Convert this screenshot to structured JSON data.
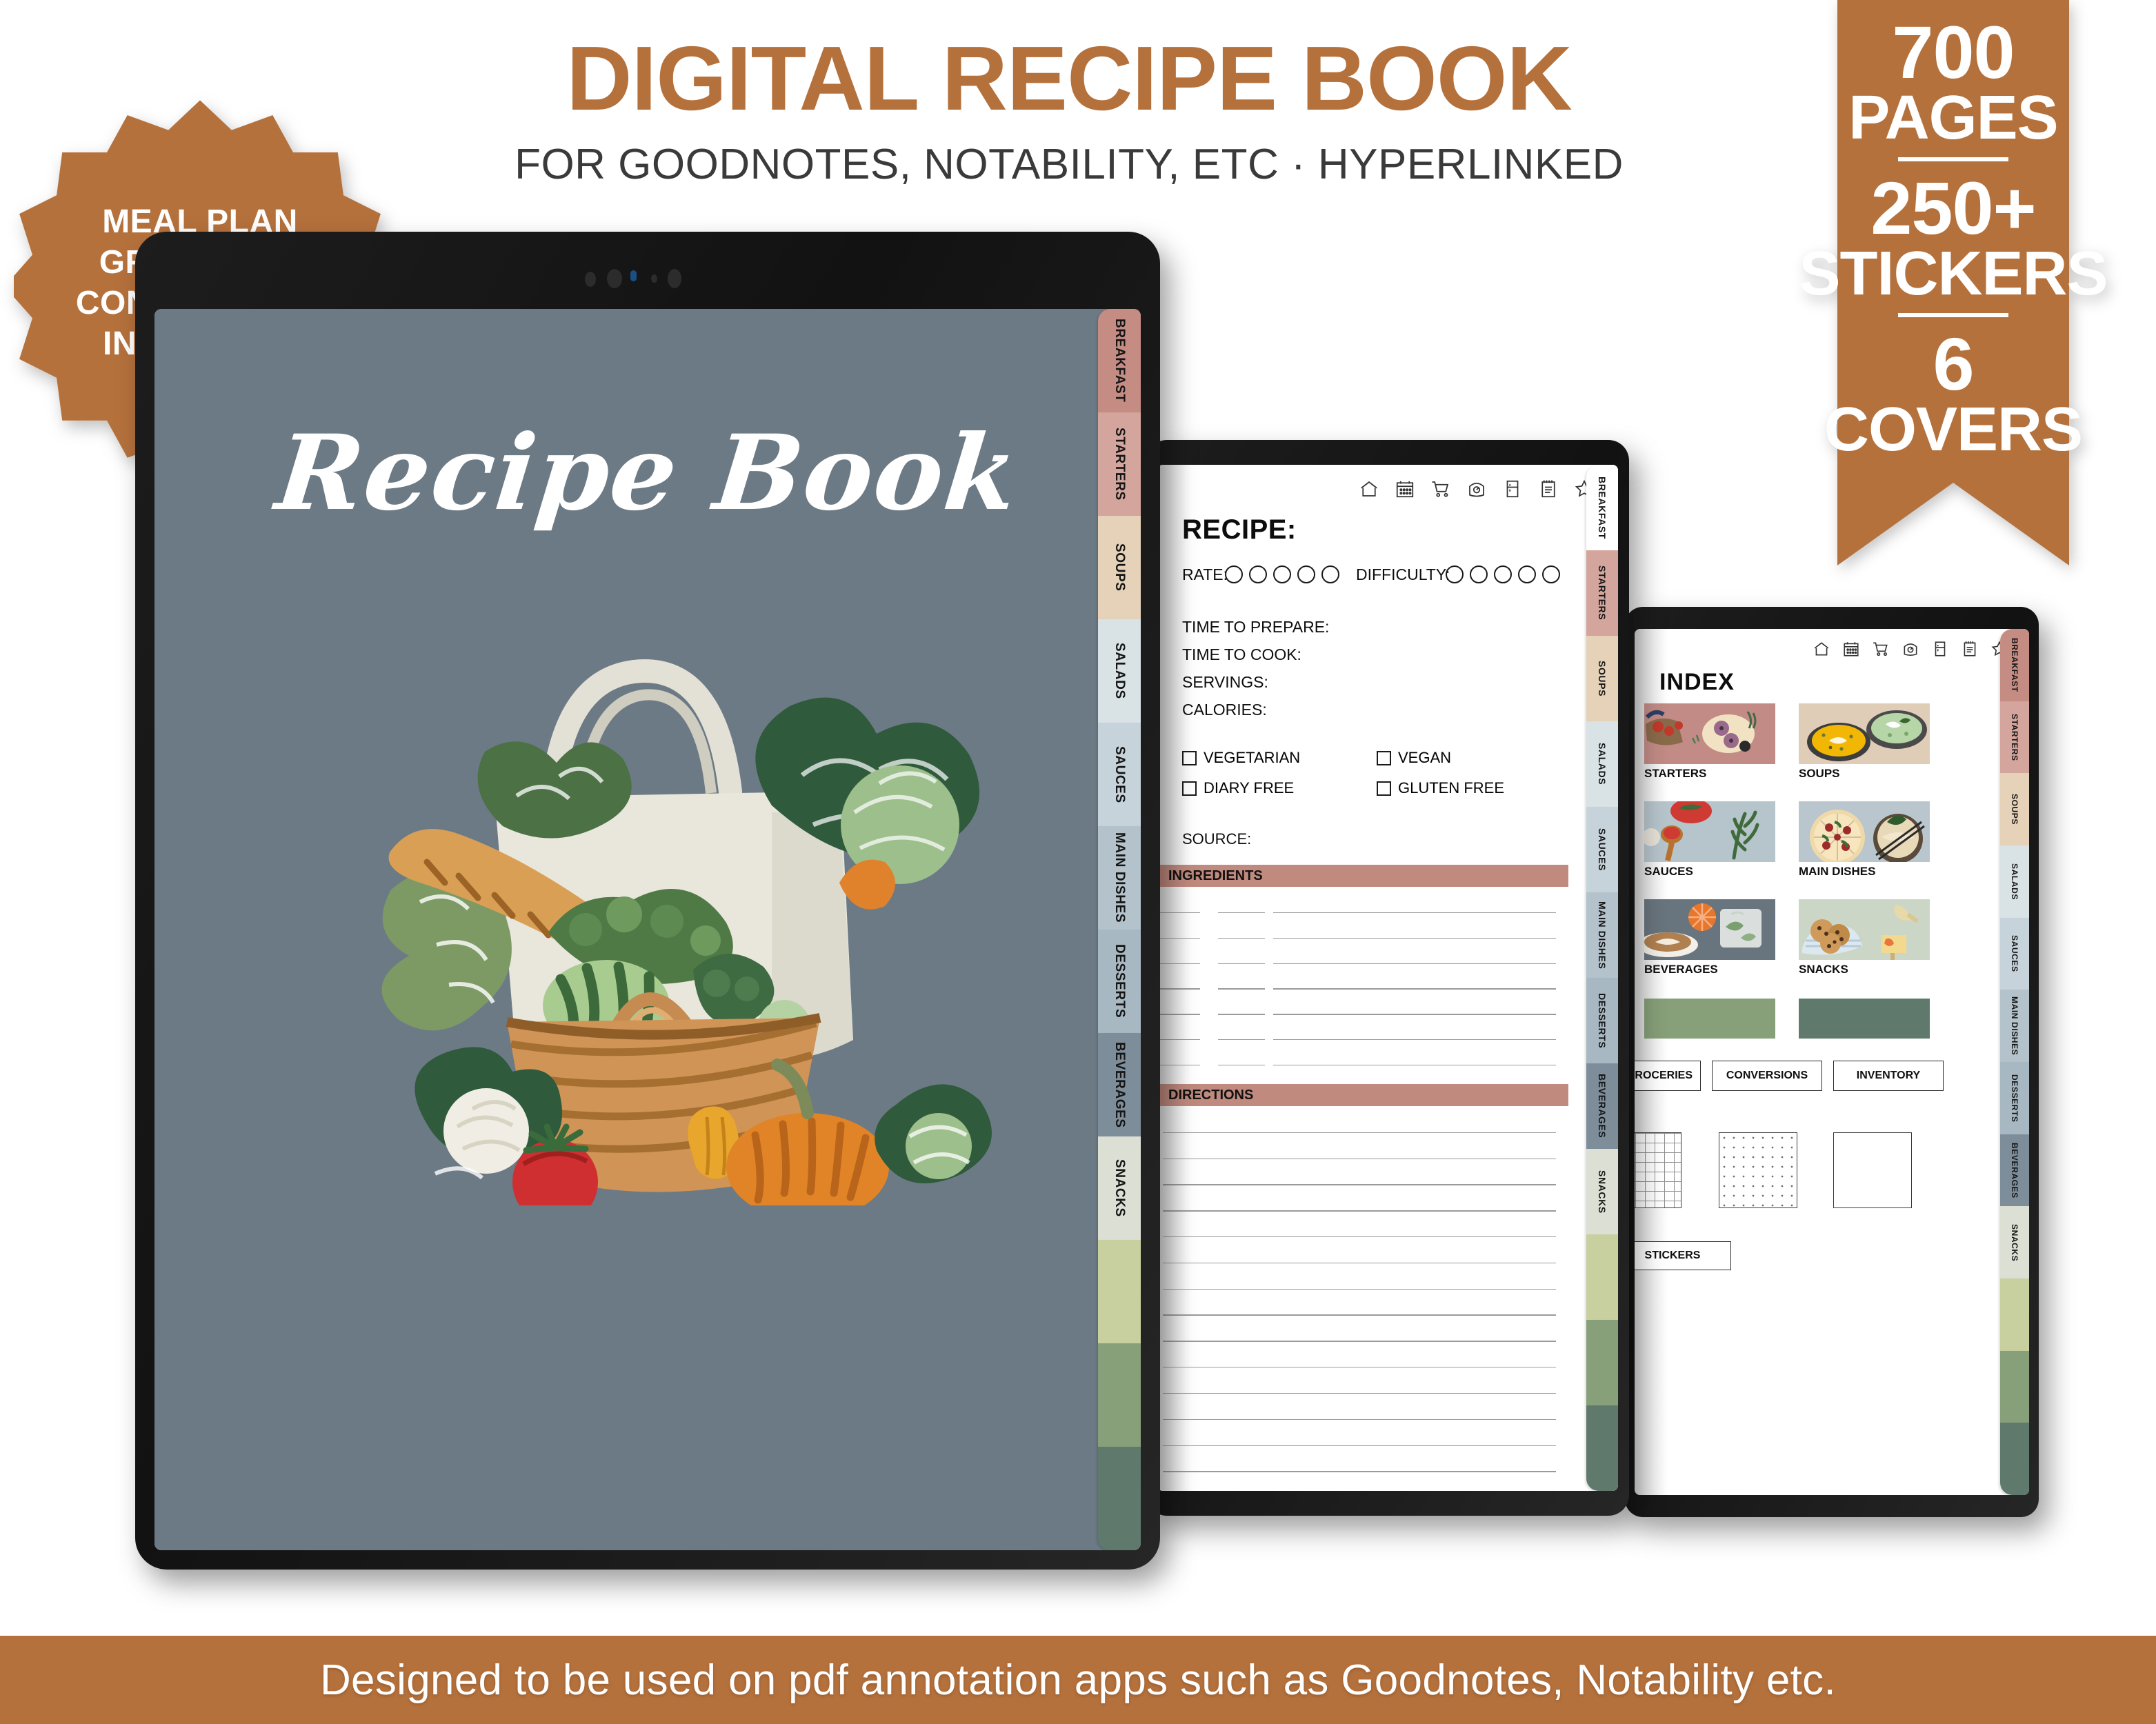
{
  "header": {
    "title": "DIGITAL RECIPE BOOK",
    "subtitle": "FOR GOODNOTES, NOTABILITY, ETC  ·  HYPERLINKED"
  },
  "badge": {
    "lines": [
      "MEAL PLAN",
      "GROCERIES",
      "CONVERSIONS",
      "INVENTORY"
    ],
    "color": "#b5713c"
  },
  "ribbon": {
    "pages_count": "700",
    "pages_label": "PAGES",
    "stickers_count": "250+",
    "stickers_label": "STICKERS",
    "covers_count": "6",
    "covers_label": "COVERS",
    "color": "#b5713c"
  },
  "footer": {
    "text": "Designed to be used on pdf annotation apps such as Goodnotes, Notability etc."
  },
  "tabs": [
    {
      "label": "BREAKFAST",
      "color": "#c58c83"
    },
    {
      "label": "STARTERS",
      "color": "#d4a59d"
    },
    {
      "label": "SOUPS",
      "color": "#e5d2b8"
    },
    {
      "label": "SALADS",
      "color": "#d9e2e5"
    },
    {
      "label": "SAUCES",
      "color": "#c6d3da"
    },
    {
      "label": "MAIN DISHES",
      "color": "#b3c2cb"
    },
    {
      "label": "DESSERTS",
      "color": "#a8b8c3"
    },
    {
      "label": "BEVERAGES",
      "color": "#7d8d9a"
    },
    {
      "label": "SNACKS",
      "color": "#dce0d4"
    },
    {
      "label": "",
      "color": "#c8d0a0"
    },
    {
      "label": "",
      "color": "#87a079"
    },
    {
      "label": "",
      "color": "#5f7a6d"
    }
  ],
  "cover": {
    "title": "Recipe Book",
    "background_color": "#6c7a85",
    "artwork_name": "watercolor-grocery-basket"
  },
  "toolbar_icons": [
    "home-icon",
    "calendar-icon",
    "shopping-cart-icon",
    "kitchen-scale-icon",
    "fridge-icon",
    "notepad-icon",
    "star-icon"
  ],
  "recipe_page": {
    "heading": "RECIPE:",
    "rate_label": "RATE:",
    "rate_circles": 5,
    "difficulty_label": "DIFFICULTY:",
    "difficulty_circles": 5,
    "fields": [
      "TIME TO PREPARE:",
      "TIME TO COOK:",
      "SERVINGS:",
      "CALORIES:"
    ],
    "checkboxes": [
      "VEGETARIAN",
      "VEGAN",
      "DIARY FREE",
      "GLUTEN FREE"
    ],
    "source_label": "SOURCE:",
    "ingredients_heading": "INGREDIENTS",
    "directions_heading": "DIRECTIONS",
    "ingredient_lines": 7,
    "direction_lines": 14,
    "section_bar_color": "#c08a7e"
  },
  "index_page": {
    "heading": "INDEX",
    "categories": [
      {
        "label": "STARTERS",
        "thumb": "starters-thumbnail",
        "bg": "#c28b85"
      },
      {
        "label": "SOUPS",
        "thumb": "soups-thumbnail",
        "bg": "#dfcdb8"
      },
      {
        "label": "SAUCES",
        "thumb": "sauces-thumbnail",
        "bg": "#b6c4cb"
      },
      {
        "label": "MAIN DISHES",
        "thumb": "main-dishes-thumbnail",
        "bg": "#b9c6cd"
      },
      {
        "label": "BEVERAGES",
        "thumb": "beverages-thumbnail",
        "bg": "#69757e"
      },
      {
        "label": "SNACKS",
        "thumb": "snacks-thumbnail",
        "bg": "#ccd6c6"
      }
    ],
    "swatches": [
      {
        "name": "green-swatch-light",
        "color": "#87a079"
      },
      {
        "name": "green-swatch-dark",
        "color": "#5f7a6d"
      }
    ],
    "buttons_row": [
      "GROCERIES",
      "CONVERSIONS",
      "INVENTORY"
    ],
    "paper_types": [
      "grid-paper",
      "dotted-paper",
      "blank-paper"
    ],
    "stickers_button": "STICKERS"
  }
}
